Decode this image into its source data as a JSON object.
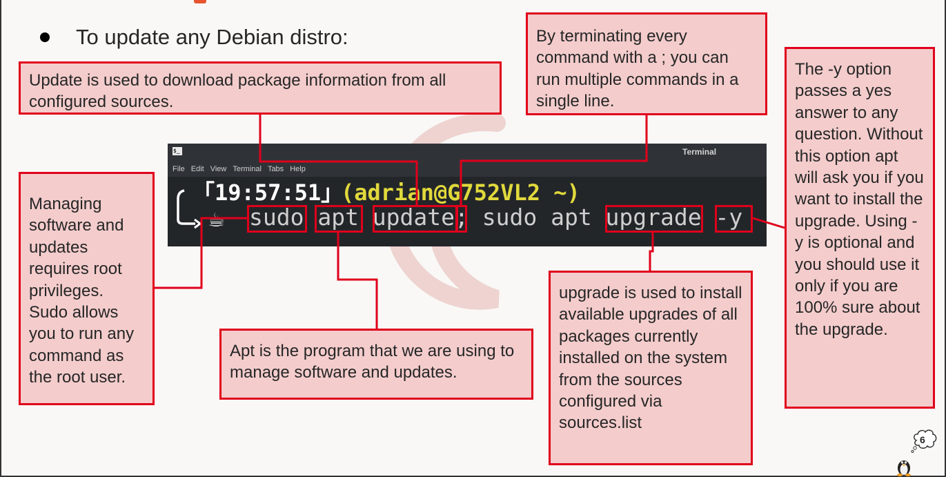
{
  "slide": {
    "bullet_text": "To update any Debian distro:",
    "page_number": "6"
  },
  "terminal": {
    "window_title": "Terminal",
    "menu": [
      "File",
      "Edit",
      "View",
      "Terminal",
      "Tabs",
      "Help"
    ],
    "time": "「19:57:51」",
    "user_host": "(adrian@G752VL2 ~)",
    "command": "sudo apt update; sudo apt upgrade -y"
  },
  "callouts": {
    "update": "Update is used to download package information from all configured sources.",
    "semicolon": "By terminating every command with a ; you can run multiple commands in a single line.",
    "y_option": "The -y option passes a yes answer to any question. Without this option apt will ask you if you want to install the upgrade. Using -y is optional and you should use it only if you are 100% sure about the upgrade.",
    "sudo": "Managing software and updates requires root privileges. Sudo allows you to run any command as the root user.",
    "apt": "Apt is the program that we are using to manage software and updates.",
    "upgrade": "upgrade is used to install available upgrades of all packages currently installed on the system from the sources configured via sources.list"
  },
  "colors": {
    "callout_fill": "#f4cccc",
    "callout_border": "#e0001b",
    "accent": "#e8552f",
    "terminal_bg": "#232629",
    "prompt_user": "#e1d93c"
  }
}
